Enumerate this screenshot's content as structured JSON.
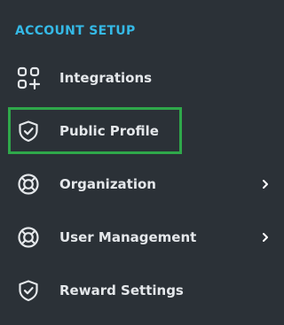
{
  "section": {
    "title": "ACCOUNT SETUP"
  },
  "colors": {
    "background": "#2b3137",
    "section_title": "#35b9e6",
    "text": "#e4e7ea",
    "selected_outline": "#2fa84a"
  },
  "items": [
    {
      "label": "Integrations",
      "icon": "grid-plus-icon",
      "has_submenu": false,
      "selected": false
    },
    {
      "label": "Public Profile",
      "icon": "shield-check-icon",
      "has_submenu": false,
      "selected": true
    },
    {
      "label": "Organization",
      "icon": "lifebuoy-icon",
      "has_submenu": true,
      "selected": false
    },
    {
      "label": "User Management",
      "icon": "lifebuoy-icon",
      "has_submenu": true,
      "selected": false
    },
    {
      "label": "Reward Settings",
      "icon": "shield-check-icon",
      "has_submenu": false,
      "selected": false
    }
  ]
}
